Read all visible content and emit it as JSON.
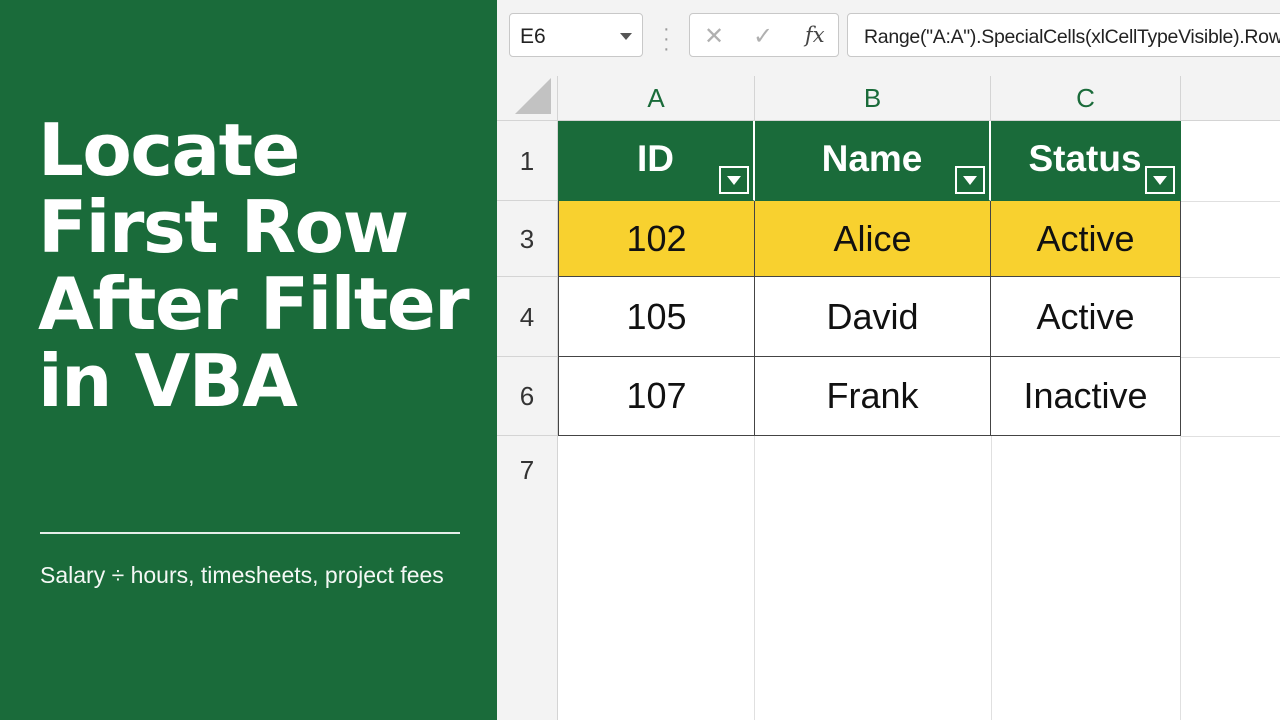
{
  "title": {
    "lines": [
      "Locate",
      "First Row",
      "After Filter",
      "in VBA"
    ]
  },
  "subtitle": "Salary ÷ hours, timesheets, project fees",
  "formula_bar": {
    "name_box": "E6",
    "fx_label": "fx",
    "cancel_icon": "✕",
    "enter_icon": "✓",
    "formula": "Range(\"A:A\").SpecialCells(xlCellTypeVisible).Row"
  },
  "sheet": {
    "columns": [
      "A",
      "B",
      "C"
    ],
    "header": {
      "row_label": "1",
      "cells": [
        "ID",
        "Name",
        "Status"
      ]
    },
    "rows": [
      {
        "row_label": "3",
        "cells": [
          "102",
          "Alice",
          "Active"
        ],
        "highlighted": true
      },
      {
        "row_label": "4",
        "cells": [
          "105",
          "David",
          "Active"
        ],
        "highlighted": false
      },
      {
        "row_label": "6",
        "cells": [
          "107",
          "Frank",
          "Inactive"
        ],
        "highlighted": false
      }
    ],
    "empty_row_label": "7"
  },
  "colors": {
    "brand_green": "#1a6b3a",
    "highlight_yellow": "#f8d12f"
  }
}
